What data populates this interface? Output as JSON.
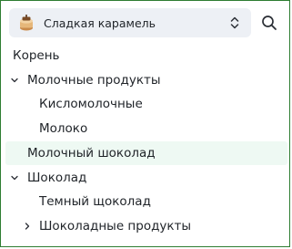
{
  "selector": {
    "label": "Сладкая карамель",
    "icon": "caramel-jar-icon"
  },
  "toolbar": {
    "search_icon": "search-icon"
  },
  "tree": {
    "items": [
      {
        "label": "Корень",
        "level": 0,
        "expander": "none",
        "selected": false
      },
      {
        "label": "Молочные продукты",
        "level": 1,
        "expander": "expanded",
        "selected": false
      },
      {
        "label": "Кисломолочные",
        "level": 2,
        "expander": "none",
        "selected": false
      },
      {
        "label": "Молоко",
        "level": 2,
        "expander": "none",
        "selected": false
      },
      {
        "label": "Молочный шоколад",
        "level": 1,
        "expander": "none",
        "selected": true
      },
      {
        "label": "Шоколад",
        "level": 1,
        "expander": "expanded",
        "selected": false
      },
      {
        "label": "Темный щоколад",
        "level": 2,
        "expander": "none",
        "selected": false
      },
      {
        "label": "Шоколадные продукты",
        "level": 2,
        "expander": "collapsed",
        "selected": false
      }
    ]
  },
  "colors": {
    "selector_bg": "#edf0f5",
    "selected_row_bg": "#eef9f3",
    "frame_border": "#2e7d32",
    "text": "#1f2328"
  }
}
